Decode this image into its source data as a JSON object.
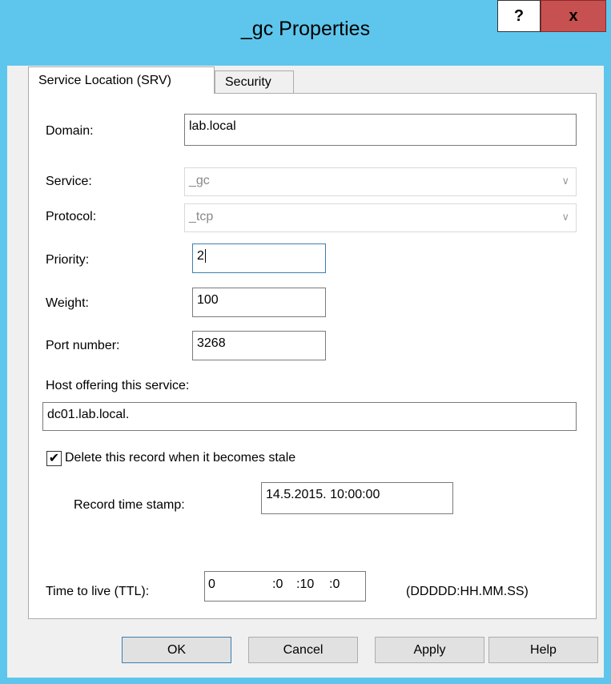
{
  "window": {
    "title": "_gc Properties",
    "help_label": "?",
    "close_label": "x"
  },
  "tabs": [
    {
      "label": "Service Location (SRV)",
      "active": true
    },
    {
      "label": "Security",
      "active": false
    }
  ],
  "form": {
    "domain_label": "Domain:",
    "domain_value": "lab.local",
    "service_label": "Service:",
    "service_value": "_gc",
    "protocol_label": "Protocol:",
    "protocol_value": "_tcp",
    "priority_label": "Priority:",
    "priority_value": "2",
    "weight_label": "Weight:",
    "weight_value": "100",
    "port_label": "Port number:",
    "port_value": "3268",
    "host_label": "Host offering this service:",
    "host_value": "dc01.lab.local.",
    "delete_stale_label": "Delete this record when it becomes stale",
    "delete_stale_checked": true,
    "timestamp_label": "Record time stamp:",
    "timestamp_value": "14.5.2015. 10:00:00",
    "ttl_label": "Time to live (TTL):",
    "ttl_days": "0",
    "ttl_hours": ":0",
    "ttl_minutes": ":10",
    "ttl_seconds": ":0",
    "ttl_format": "(DDDDD:HH.MM.SS)"
  },
  "buttons": {
    "ok": "OK",
    "cancel": "Cancel",
    "apply": "Apply",
    "help": "Help"
  },
  "colors": {
    "titlebar": "#5ec6ec",
    "close": "#c75050",
    "focus_border": "#3c7fb1"
  }
}
